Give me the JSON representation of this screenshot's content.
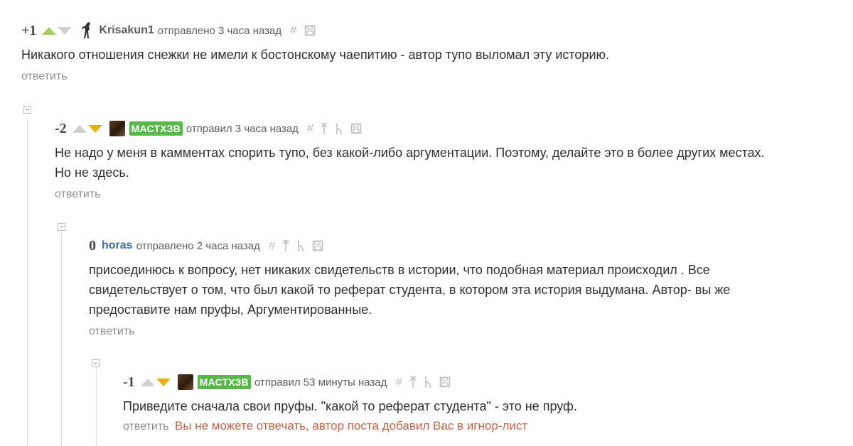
{
  "comments": [
    {
      "rating": "+1",
      "username": "Krisakun1",
      "posted": "отправлено 3 часа назад",
      "text": "Никакого отношения снежки не имели к бостонскому чаепитию - автор тупо выломал эту историю.",
      "reply": "ответить"
    },
    {
      "rating": "-2",
      "username": "МАСТХЗВ",
      "posted": "отправил 3 часа назад",
      "text_line1": "Не надо у меня в камментах спорить тупо, без какой-либо аргументации. Поэтому, делайте это в более других местах.",
      "text_line2": "Но не здесь.",
      "reply": "ответить"
    },
    {
      "rating": "0",
      "username": "horas",
      "posted": "отправлено 2 часа назад",
      "text_line1": "присоединюсь к вопросу, нет никаких свидетельств в истории, что подобная материал происходил . Все",
      "text_line2": "свидетельствует о том, что был какой то реферат студента, в котором эта история выдумана. Автор- вы же",
      "text_line3": "предоставите нам пруфы, Аргументированные.",
      "reply": "ответить"
    },
    {
      "rating": "-1",
      "username": "МАСТХЗВ",
      "posted": "отправил 53 минуты назад",
      "text": "Приведите сначала свои пруфы. \"какой то реферат студента\" - это не пруф.",
      "reply": "ответить",
      "notice": "Вы не можете отвечать, автор поста добавил Вас в игнор-лист"
    }
  ],
  "icons": {
    "link": "hash-icon",
    "save": "floppy-save-icon",
    "parent": "arrow-up-icon",
    "branch": "branch-icon"
  },
  "colors": {
    "badge": "#56b847",
    "vote_up": "#a6cf5a",
    "vote_down": "#e6b012",
    "notice": "#c0654a",
    "username_link": "#3a6e9b"
  }
}
